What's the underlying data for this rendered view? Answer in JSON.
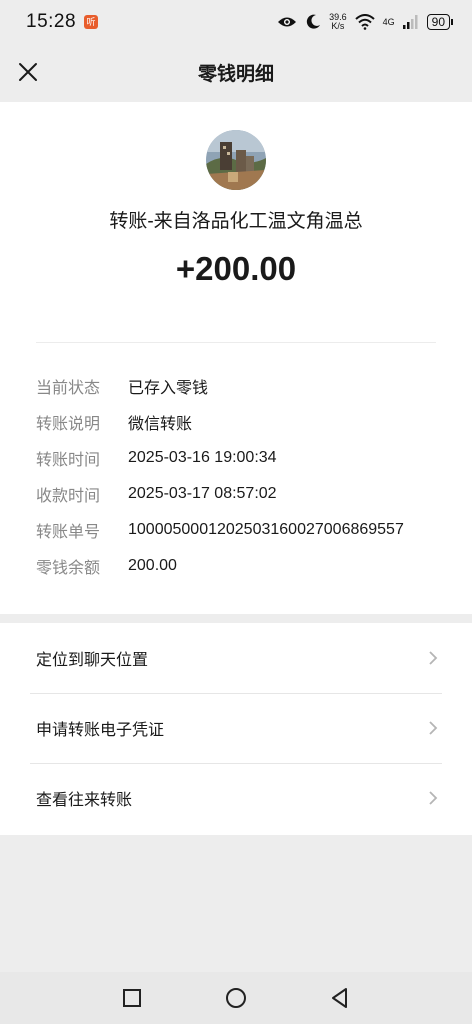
{
  "status_bar": {
    "time": "15:28",
    "app_badge": "听",
    "speed_value": "39.6",
    "speed_unit": "K/s",
    "network": "4G",
    "battery": "90"
  },
  "header": {
    "title": "零钱明细"
  },
  "transfer": {
    "headline": "转账-来自洛品化工温文角温总",
    "amount": "+200.00",
    "details": [
      {
        "label": "当前状态",
        "value": "已存入零钱"
      },
      {
        "label": "转账说明",
        "value": "微信转账"
      },
      {
        "label": "转账时间",
        "value": "2025-03-16 19:00:34"
      },
      {
        "label": "收款时间",
        "value": "2025-03-17 08:57:02"
      },
      {
        "label": "转账单号",
        "value": "1000050001202503160027006869557"
      },
      {
        "label": "零钱余额",
        "value": "200.00"
      }
    ]
  },
  "actions": [
    {
      "label": "定位到聊天位置"
    },
    {
      "label": "申请转账电子凭证"
    },
    {
      "label": "查看往来转账"
    }
  ],
  "colors": {
    "page_bg": "#ededed",
    "card_bg": "#ffffff",
    "label_gray": "#888888"
  }
}
